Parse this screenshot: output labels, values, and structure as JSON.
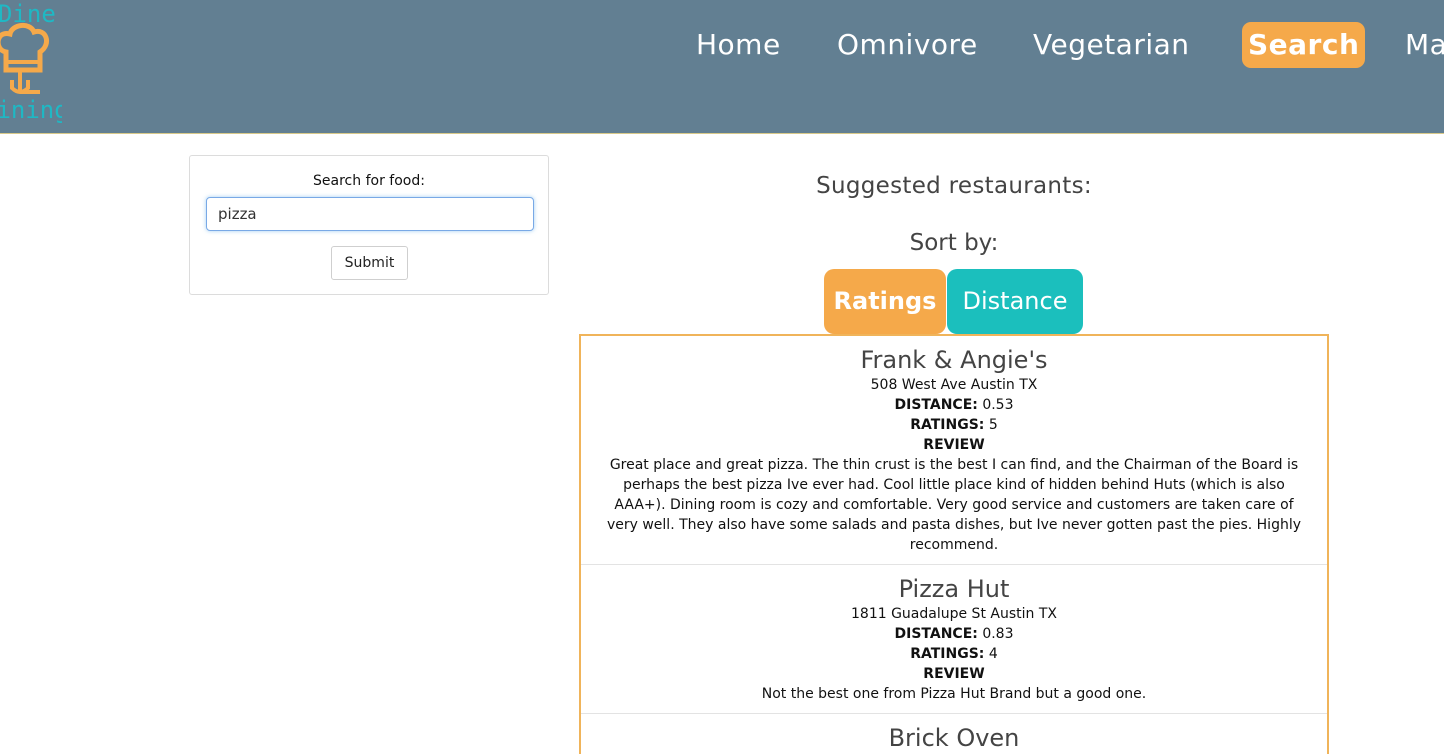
{
  "logo": {
    "text_top": "Dine",
    "text_bottom": "Dining"
  },
  "nav": [
    {
      "label": "Home",
      "active": false
    },
    {
      "label": "Omnivore",
      "active": false
    },
    {
      "label": "Vegetarian",
      "active": false
    },
    {
      "label": "Search",
      "active": true
    },
    {
      "label": "Ma",
      "active": false
    }
  ],
  "search": {
    "label": "Search for food:",
    "value": "pizza",
    "submit_label": "Submit"
  },
  "results_header": {
    "title": "Suggested restaurants:",
    "sort_label": "Sort by:",
    "sort_ratings": "Ratings",
    "sort_distance": "Distance"
  },
  "labels": {
    "distance": "DISTANCE:",
    "ratings": "RATINGS:",
    "review": "REVIEW"
  },
  "restaurants": [
    {
      "name": "Frank & Angie's",
      "address": "508 West Ave Austin TX",
      "distance": "0.53",
      "ratings": "5",
      "review": "Great place and great pizza. The thin crust is the best I can find, and the Chairman of the Board is perhaps the best pizza Ive ever had. Cool little place kind of hidden behind Huts (which is also AAA+). Dining room is cozy and comfortable. Very good service and customers are taken care of very well. They also have some salads and pasta dishes, but Ive never gotten past the pies. Highly recommend."
    },
    {
      "name": "Pizza Hut",
      "address": "1811 Guadalupe St Austin TX",
      "distance": "0.83",
      "ratings": "4",
      "review": "Not the best one from Pizza Hut Brand but a good one."
    },
    {
      "name": "Brick Oven",
      "address": "",
      "distance": "",
      "ratings": "",
      "review": ""
    }
  ],
  "colors": {
    "header_bg": "#627f92",
    "accent_orange": "#f5a94a",
    "accent_teal": "#1bbfbd",
    "logo_teal": "#1fb8c4",
    "logo_orange": "#f5a94a"
  }
}
